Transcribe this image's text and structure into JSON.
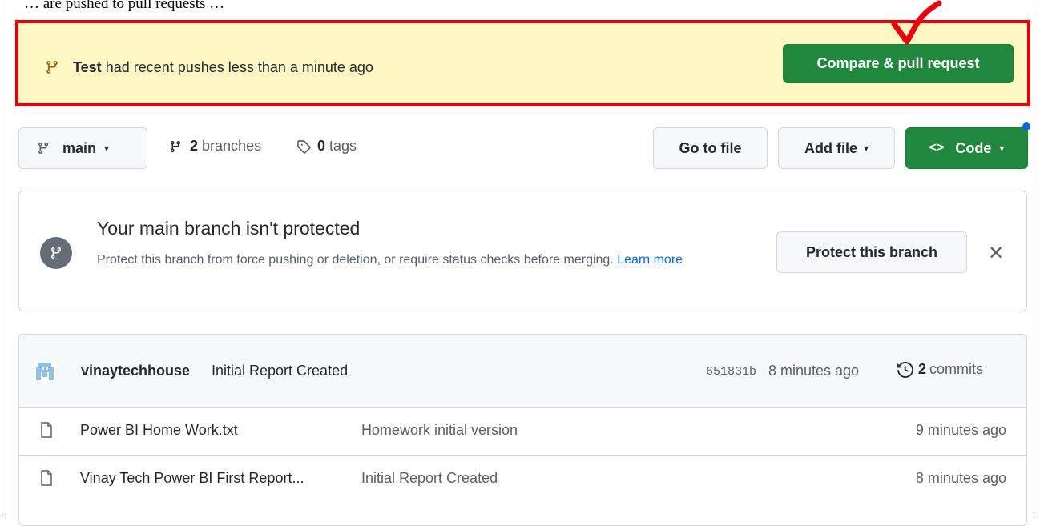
{
  "top_caption": "… are pushed to pull requests …",
  "banner": {
    "branch_name": "Test",
    "message": "had recent pushes less than a minute ago",
    "button_label": "Compare & pull request"
  },
  "toolbar": {
    "branch": "main",
    "branches_count": "2",
    "branches_label": "branches",
    "tags_count": "0",
    "tags_label": "tags",
    "go_to_file": "Go to file",
    "add_file": "Add file",
    "code": "Code"
  },
  "protect": {
    "title": "Your main branch isn't protected",
    "description": "Protect this branch from force pushing or deletion, or require status checks before merging.",
    "learn_more": "Learn more",
    "button_label": "Protect this branch"
  },
  "commit": {
    "author": "vinaytechhouse",
    "message": "Initial Report Created",
    "sha": "651831b",
    "time": "8 minutes ago",
    "count": "2",
    "count_label": "commits"
  },
  "files": [
    {
      "name": "Power BI Home Work.txt",
      "message": "Homework initial version",
      "age": "9 minutes ago"
    },
    {
      "name": "Vinay Tech Power BI First Report...",
      "message": "Initial Report Created",
      "age": "8 minutes ago"
    }
  ],
  "colors": {
    "banner_bg": "#fff8c5",
    "highlight_border": "#e8000b",
    "primary_green": "#1f883d",
    "link_blue": "#0969da"
  }
}
